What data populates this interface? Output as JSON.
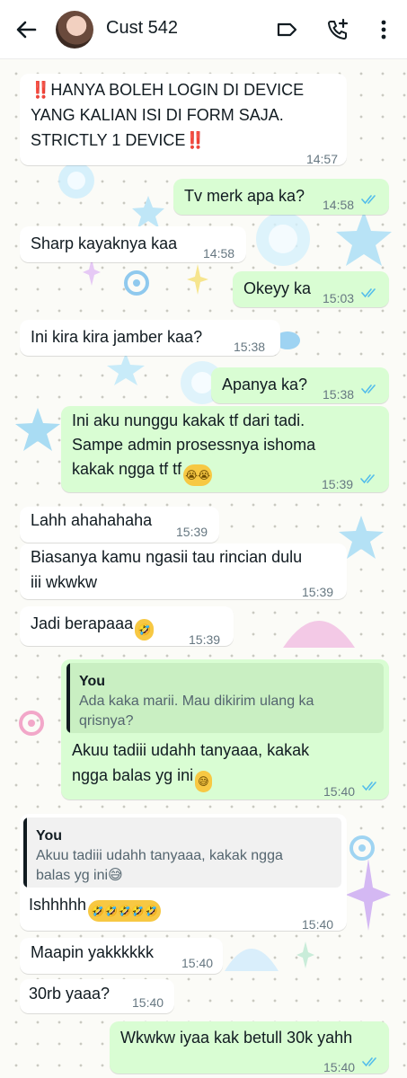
{
  "header": {
    "contact_name": "Cust 542"
  },
  "colors": {
    "incoming_bubble": "#ffffff",
    "outgoing_bubble": "#d9fdd3",
    "timestamp": "#667781",
    "read_ticks": "#53bdeb",
    "quote_bar": "#111b21"
  },
  "messages": [
    {
      "dir": "in",
      "lines": [
        "‼️HANYA BOLEH LOGIN DI DEVICE",
        "YANG KALIAN ISI DI FORM SAJA.",
        "STRICTLY 1 DEVICE‼️"
      ],
      "time": "14:57"
    },
    {
      "dir": "out",
      "lines": [
        "Tv merk apa ka?"
      ],
      "time": "14:58",
      "read": true
    },
    {
      "dir": "in",
      "lines": [
        "Sharp kayaknya kaa"
      ],
      "time": "14:58"
    },
    {
      "dir": "out",
      "lines": [
        "Okeyy ka"
      ],
      "time": "15:03",
      "read": true
    },
    {
      "dir": "in",
      "lines": [
        "Ini kira kira jamber kaa?"
      ],
      "time": "15:38"
    },
    {
      "dir": "out",
      "lines": [
        "Apanya ka?"
      ],
      "time": "15:38",
      "read": true
    },
    {
      "dir": "out",
      "lines": [
        "Ini aku nunggu kakak tf dari tadi.",
        "Sampe admin prosessnya ishoma",
        "kakak ngga tf tf"
      ],
      "emoji": "😭😭",
      "time": "15:39",
      "read": true
    },
    {
      "dir": "in",
      "lines": [
        "Lahh ahahahaha"
      ],
      "time": "15:39"
    },
    {
      "dir": "in",
      "lines": [
        "Biasanya kamu ngasii tau rincian dulu",
        "iii wkwkw"
      ],
      "time": "15:39"
    },
    {
      "dir": "in",
      "lines": [
        "Jadi berapaaa"
      ],
      "emoji": "🤣",
      "time": "15:39"
    },
    {
      "dir": "out",
      "quote": {
        "name": "You",
        "lines": [
          "Ada kaka marii. Mau dikirim ulang ka",
          "qrisnya?"
        ]
      },
      "lines": [
        "Akuu tadiii udahh tanyaaa, kakak",
        "ngga balas yg ini"
      ],
      "emoji": "😅",
      "time": "15:40",
      "read": true
    },
    {
      "dir": "in",
      "quote": {
        "name": "You",
        "lines": [
          "Akuu tadiii udahh tanyaaa, kakak ngga",
          "balas yg ini😅"
        ]
      },
      "lines": [
        "Ishhhhh"
      ],
      "emoji": "🤣🤣🤣🤣🤣",
      "time": "15:40"
    },
    {
      "dir": "in",
      "lines": [
        "Maapin yakkkkkk"
      ],
      "time": "15:40"
    },
    {
      "dir": "in",
      "lines": [
        "30rb yaaa?"
      ],
      "time": "15:40"
    },
    {
      "dir": "out",
      "lines": [
        "Wkwkw iyaa kak betull 30k yahh"
      ],
      "time": "15:40",
      "read": true
    }
  ]
}
